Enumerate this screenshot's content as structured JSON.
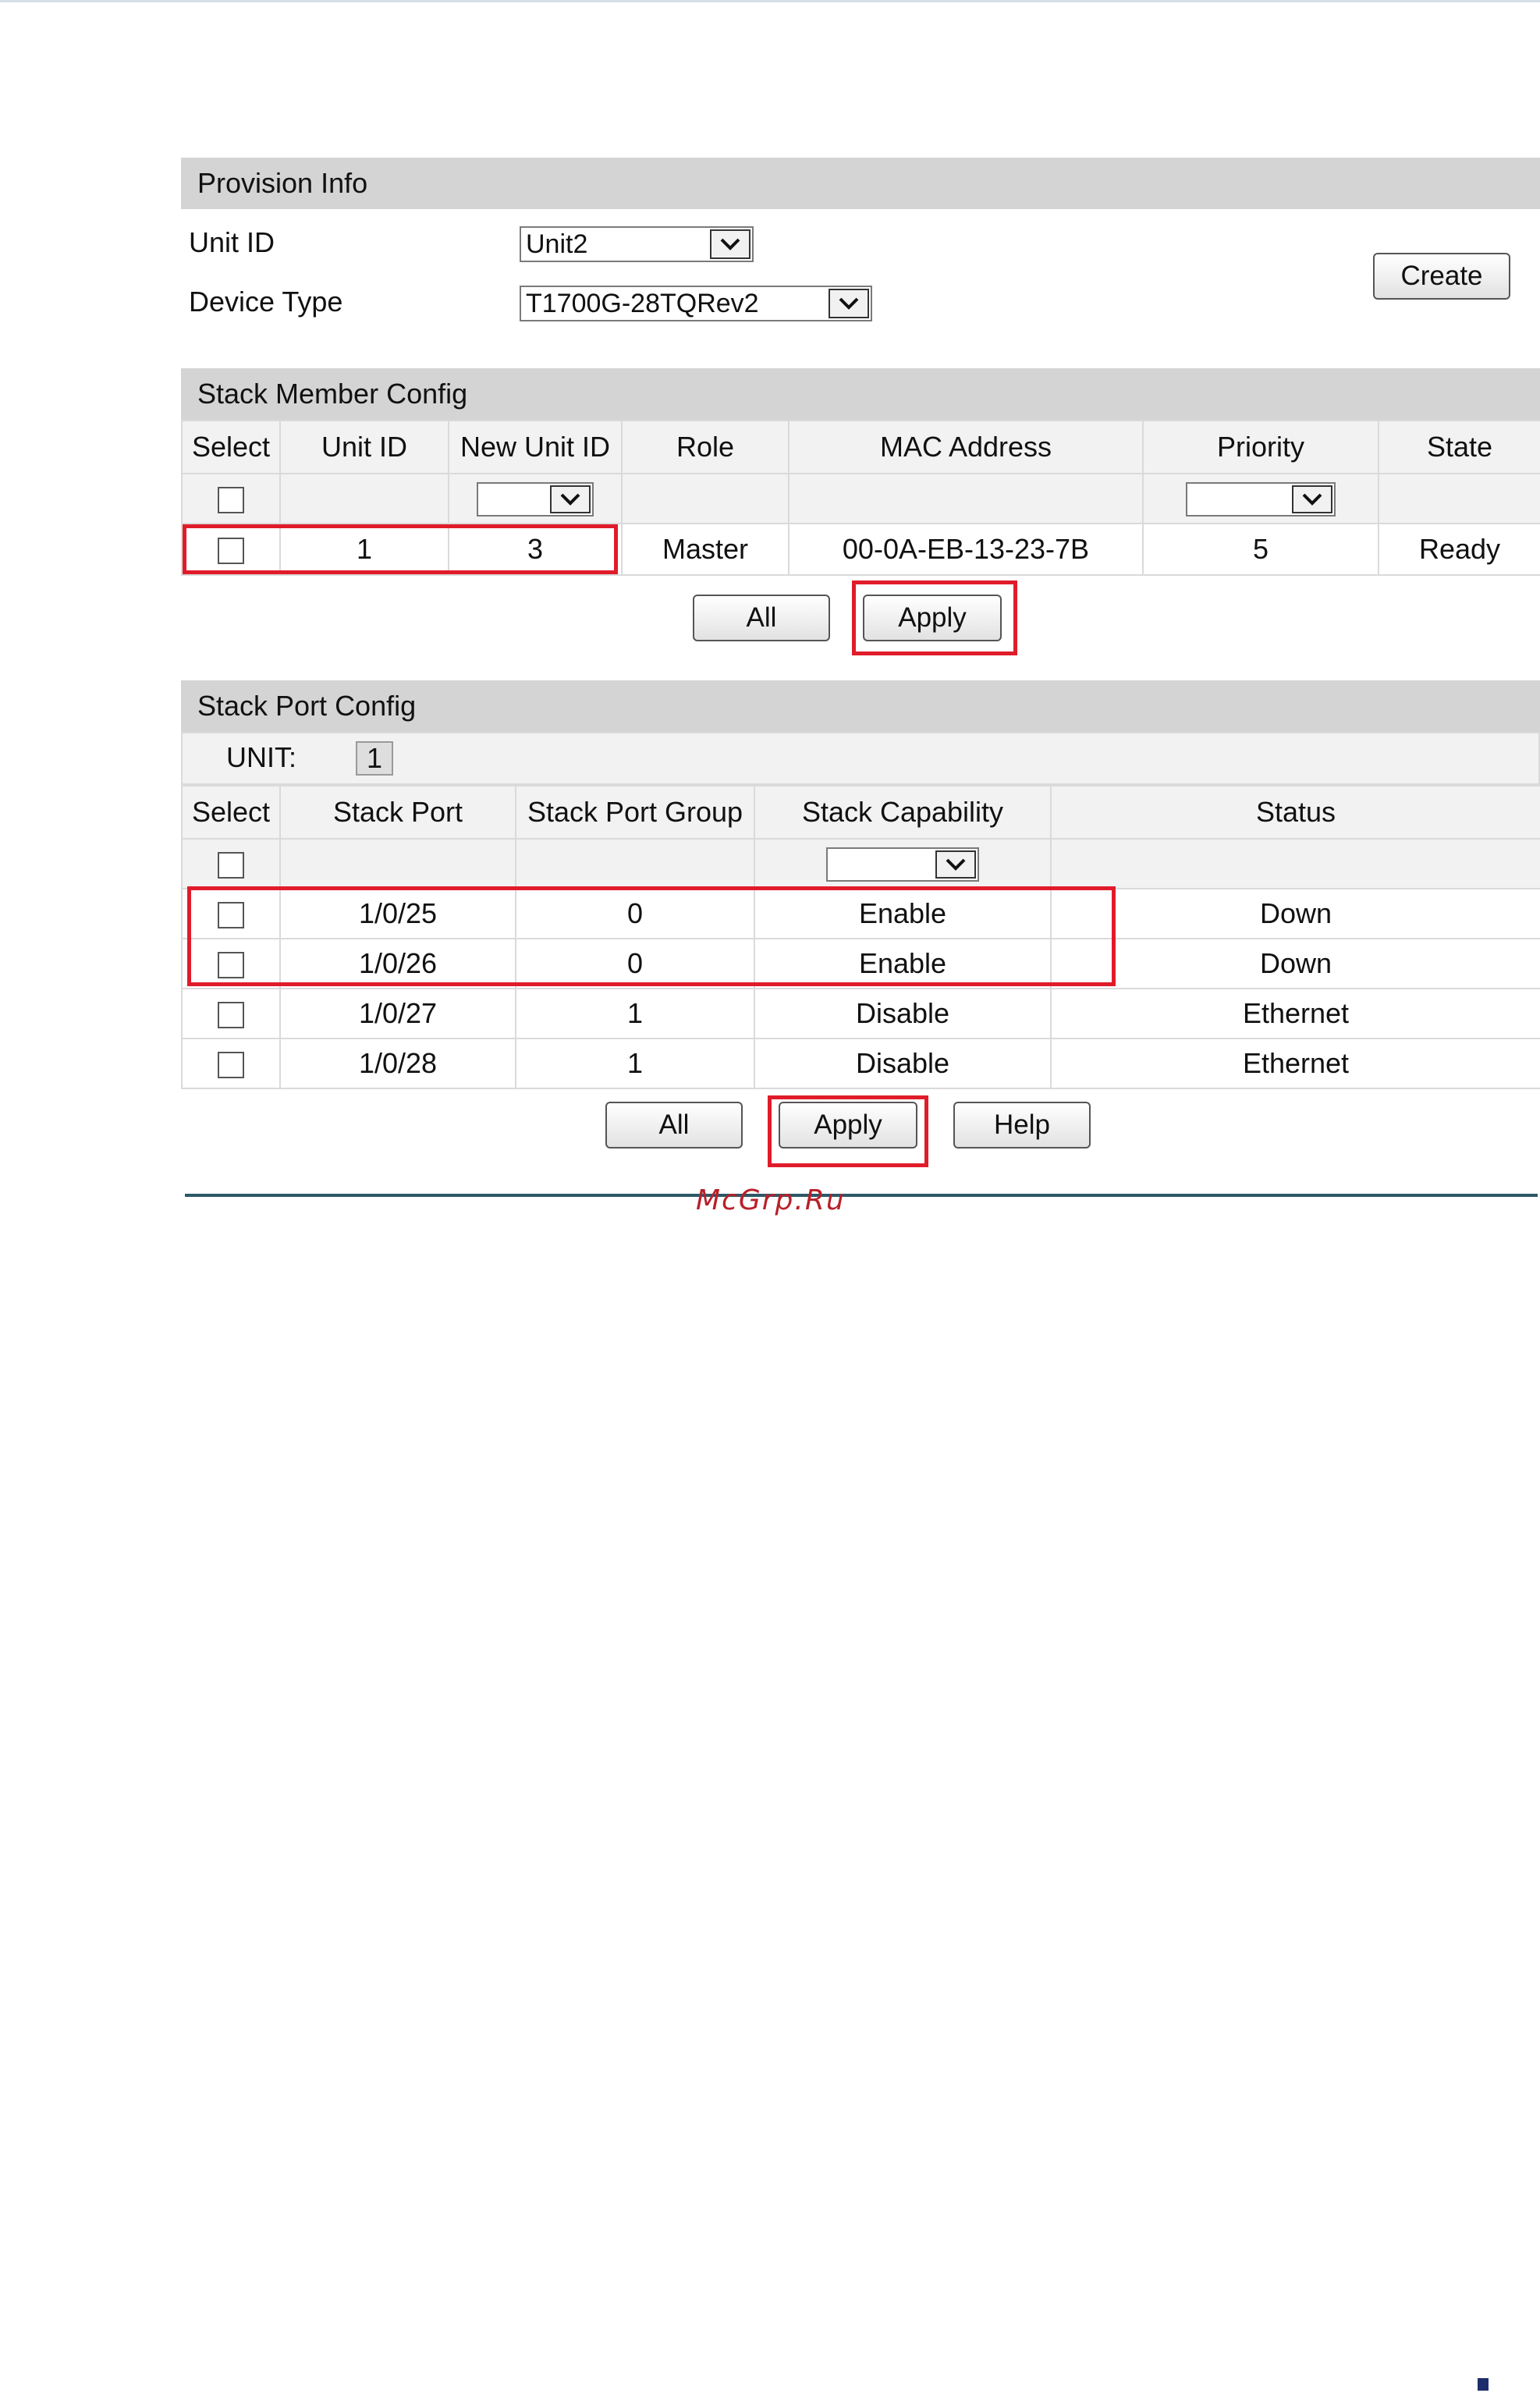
{
  "provision": {
    "title": "Provision Info",
    "unit_id_label": "Unit ID",
    "unit_id_value": "Unit2",
    "device_type_label": "Device Type",
    "device_type_value": "T1700G-28TQRev2",
    "create_label": "Create"
  },
  "member": {
    "title": "Stack Member Config",
    "headers": [
      "Select",
      "Unit ID",
      "New Unit ID",
      "Role",
      "MAC Address",
      "Priority",
      "State"
    ],
    "rows": [
      {
        "unit_id": "1",
        "new_unit_id": "3",
        "role": "Master",
        "mac": "00-0A-EB-13-23-7B",
        "priority": "5",
        "state": "Ready"
      }
    ],
    "all_label": "All",
    "apply_label": "Apply"
  },
  "port": {
    "title": "Stack Port Config",
    "unit_label": "UNIT:",
    "unit_value": "1",
    "headers": [
      "Select",
      "Stack Port",
      "Stack Port Group",
      "Stack Capability",
      "Status"
    ],
    "rows": [
      {
        "port": "1/0/25",
        "group": "0",
        "capability": "Enable",
        "status": "Down"
      },
      {
        "port": "1/0/26",
        "group": "0",
        "capability": "Enable",
        "status": "Down"
      },
      {
        "port": "1/0/27",
        "group": "1",
        "capability": "Disable",
        "status": "Ethernet"
      },
      {
        "port": "1/0/28",
        "group": "1",
        "capability": "Disable",
        "status": "Ethernet"
      }
    ],
    "all_label": "All",
    "apply_label": "Apply",
    "help_label": "Help"
  },
  "watermark": "McGrp.Ru",
  "icons": {
    "dropdown": "chevron-down-icon"
  },
  "colors": {
    "highlight": "#e01c2a",
    "header_bg": "#d4d4d4",
    "footer_line": "#2d5866",
    "watermark": "#b8212a"
  }
}
